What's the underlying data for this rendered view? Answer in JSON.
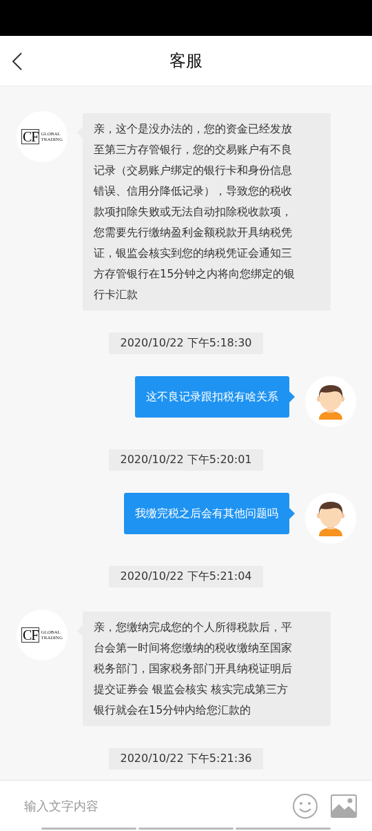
{
  "header": {
    "title": "客服"
  },
  "messages": [
    {
      "kind": "received",
      "logo": {
        "mark": "CF",
        "line_1": "GLOBAL",
        "line_2": "TRADING"
      },
      "lines": [
        "亲，这个是没办法的，您的资金已经发放",
        "至第三方存管银行，您的交易账户有不良",
        "记录（交易账户绑定的银行卡和身份信息",
        "错误、信用分降低记录），导致您的税收",
        "款项扣除失败或无法自动扣除税收款项，",
        "您需要先行缴纳盈利金额税款开具纳税凭",
        "证，银监会核实到您的纳税凭证会通知三",
        "方存管银行在15分钟之内将向您绑定的银",
        "行卡汇款"
      ]
    },
    {
      "kind": "timestamp",
      "text": "2020/10/22 下午5:18:30"
    },
    {
      "kind": "sent",
      "text": "这不良记录跟扣税有啥关系"
    },
    {
      "kind": "timestamp",
      "text": "2020/10/22 下午5:20:01"
    },
    {
      "kind": "sent",
      "text": "我缴完税之后会有其他问题吗"
    },
    {
      "kind": "timestamp",
      "text": "2020/10/22 下午5:21:04"
    },
    {
      "kind": "received",
      "logo": {
        "mark": "CF",
        "line_1": "GLOBAL",
        "line_2": "TRADING"
      },
      "lines": [
        "亲，您缴纳完成您的个人所得税款后，平",
        "台会第一时间将您缴纳的税收缴纳至国家",
        "税务部门，国家税务部门开具纳税证明后",
        "提交证券会 银监会核实 核实完成第三方",
        "银行就会在15分钟内给您汇款的"
      ]
    },
    {
      "kind": "timestamp",
      "text": "2020/10/22 下午5:21:36"
    }
  ],
  "composer": {
    "placeholder": "输入文字内容"
  }
}
